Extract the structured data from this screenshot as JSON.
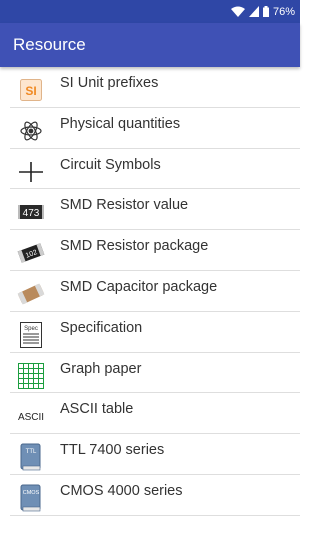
{
  "status": {
    "battery": "76%"
  },
  "app_bar": {
    "title": "Resource"
  },
  "items": [
    {
      "label": "SI Unit prefixes",
      "icon": "si-prefix-icon",
      "icon_text": "SI"
    },
    {
      "label": "Physical quantities",
      "icon": "atom-icon"
    },
    {
      "label": "Circuit Symbols",
      "icon": "circuit-symbol-icon"
    },
    {
      "label": "SMD Resistor value",
      "icon": "smd-resistor-value-icon",
      "icon_text": "473"
    },
    {
      "label": "SMD Resistor package",
      "icon": "smd-resistor-package-icon",
      "icon_text": "102"
    },
    {
      "label": "SMD Capacitor package",
      "icon": "smd-capacitor-icon"
    },
    {
      "label": "Specification",
      "icon": "specification-icon",
      "icon_text": "Spec"
    },
    {
      "label": "Graph paper",
      "icon": "graph-paper-icon"
    },
    {
      "label": "ASCII table",
      "icon": "ascii-icon",
      "icon_text": "ASCII"
    },
    {
      "label": "TTL 7400 series",
      "icon": "ttl-book-icon",
      "icon_text": "TTL"
    },
    {
      "label": "CMOS 4000 series",
      "icon": "cmos-book-icon",
      "icon_text": "CMOS"
    }
  ],
  "colors": {
    "status_bar": "#2f47a6",
    "app_bar": "#3f51b5",
    "si_orange": "#f08a24",
    "graph_green": "#1b9e3e",
    "book_blue": "#6f8fb5"
  }
}
